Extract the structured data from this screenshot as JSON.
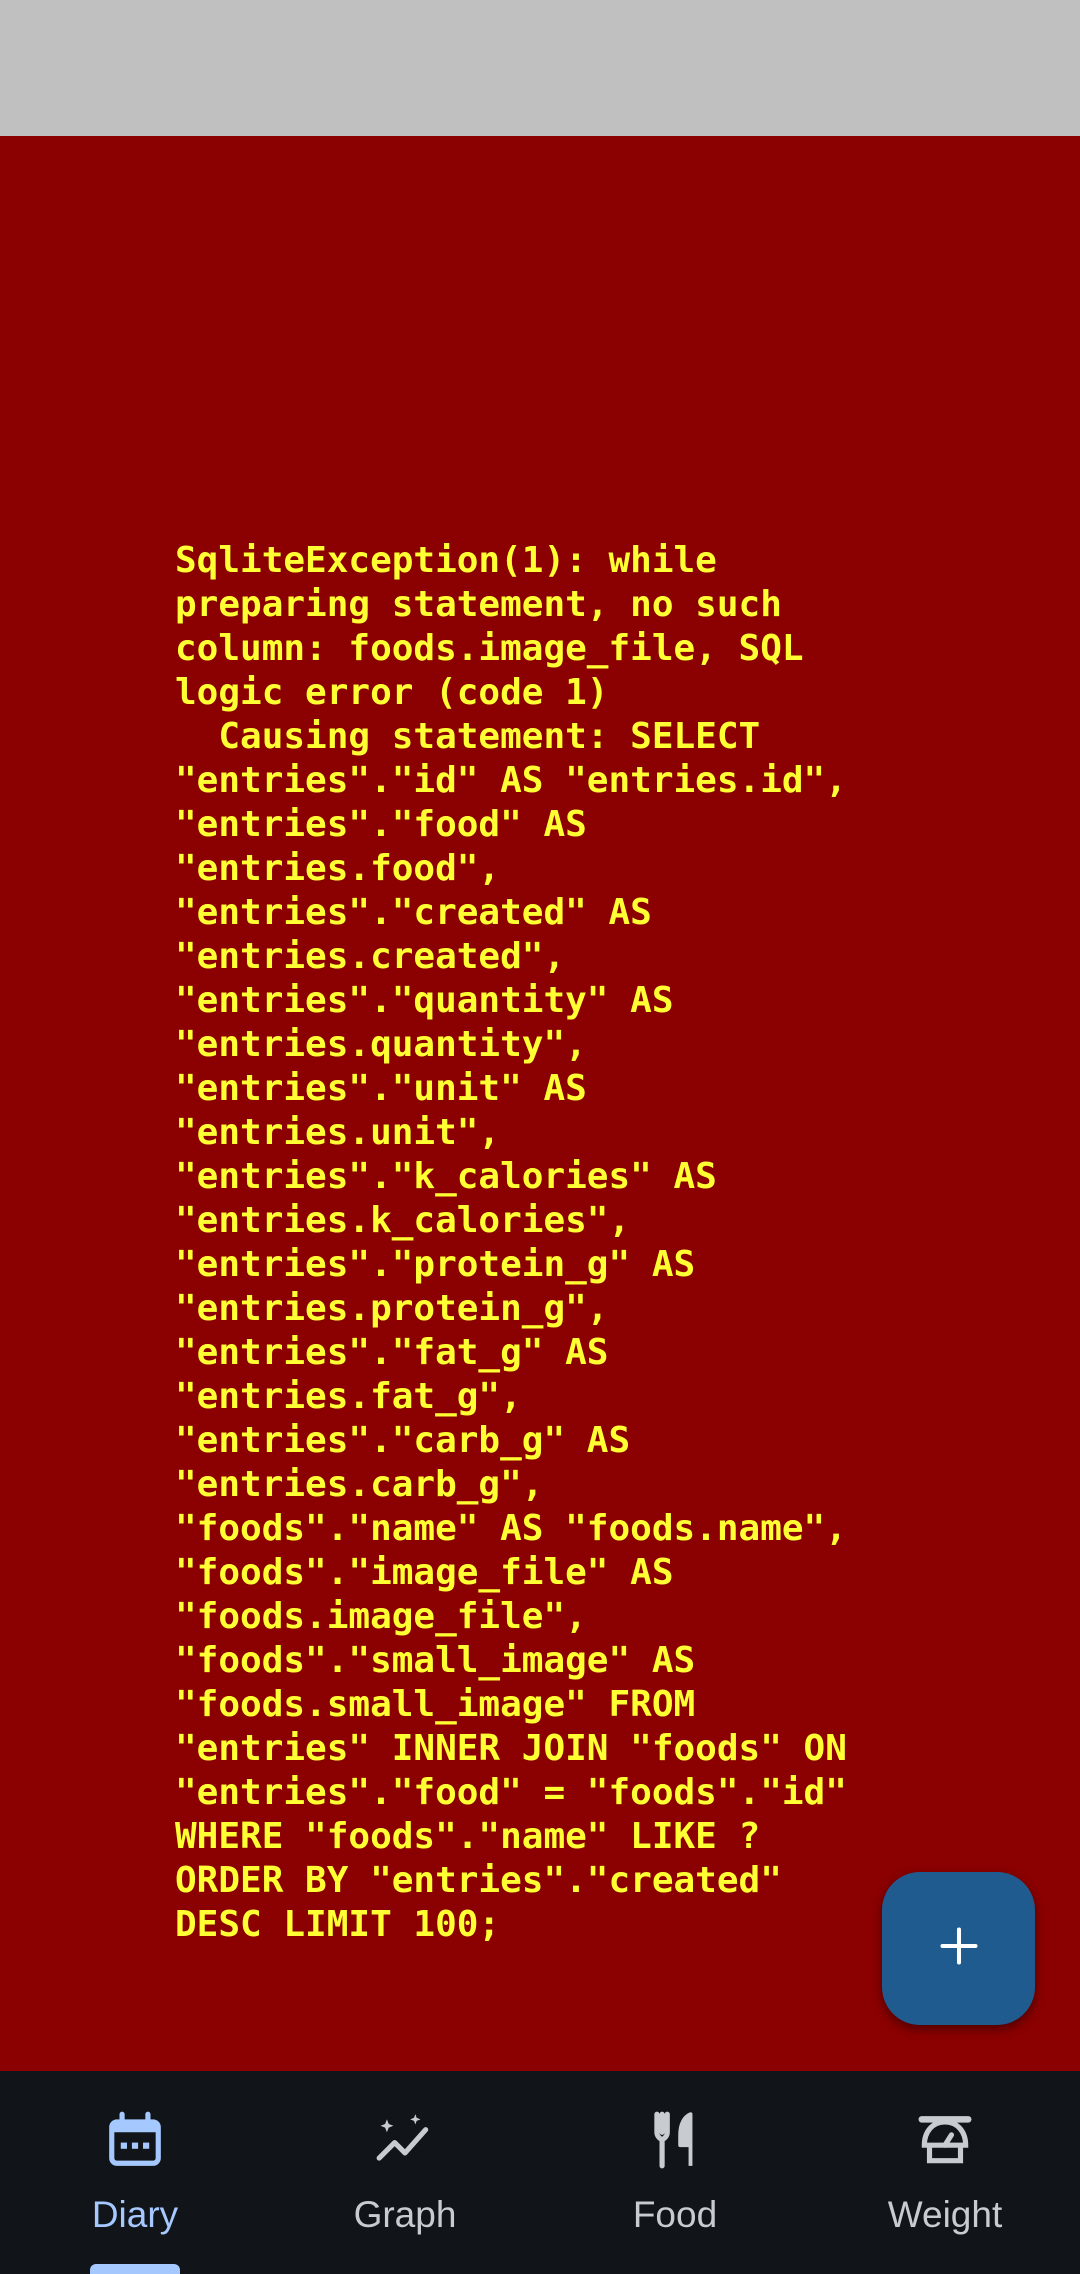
{
  "error": {
    "message": "SqliteException(1): while\npreparing statement, no such\ncolumn: foods.image_file, SQL\nlogic error (code 1)\n  Causing statement: SELECT\n\"entries\".\"id\" AS \"entries.id\",\n\"entries\".\"food\" AS\n\"entries.food\",\n\"entries\".\"created\" AS\n\"entries.created\",\n\"entries\".\"quantity\" AS\n\"entries.quantity\",\n\"entries\".\"unit\" AS\n\"entries.unit\",\n\"entries\".\"k_calories\" AS\n\"entries.k_calories\",\n\"entries\".\"protein_g\" AS\n\"entries.protein_g\",\n\"entries\".\"fat_g\" AS\n\"entries.fat_g\",\n\"entries\".\"carb_g\" AS\n\"entries.carb_g\",\n\"foods\".\"name\" AS \"foods.name\",\n\"foods\".\"image_file\" AS\n\"foods.image_file\",\n\"foods\".\"small_image\" AS\n\"foods.small_image\" FROM\n\"entries\" INNER JOIN \"foods\" ON\n\"entries\".\"food\" = \"foods\".\"id\"\nWHERE \"foods\".\"name\" LIKE ?\nORDER BY \"entries\".\"created\"\nDESC LIMIT 100;"
  },
  "fab": {
    "icon": "plus-icon"
  },
  "nav": {
    "items": [
      {
        "label": "Diary",
        "icon": "calendar-icon",
        "active": true
      },
      {
        "label": "Graph",
        "icon": "graph-icon",
        "active": false
      },
      {
        "label": "Food",
        "icon": "restaurant-icon",
        "active": false
      },
      {
        "label": "Weight",
        "icon": "scale-icon",
        "active": false
      }
    ]
  },
  "colors": {
    "error_background": "#8b0000",
    "error_text": "#ffff33",
    "status_bar": "#c0c0c0",
    "fab": "#1f5b8f",
    "nav_background": "#111418",
    "nav_active": "#a5c8ff",
    "nav_inactive": "#c8cbd0"
  }
}
